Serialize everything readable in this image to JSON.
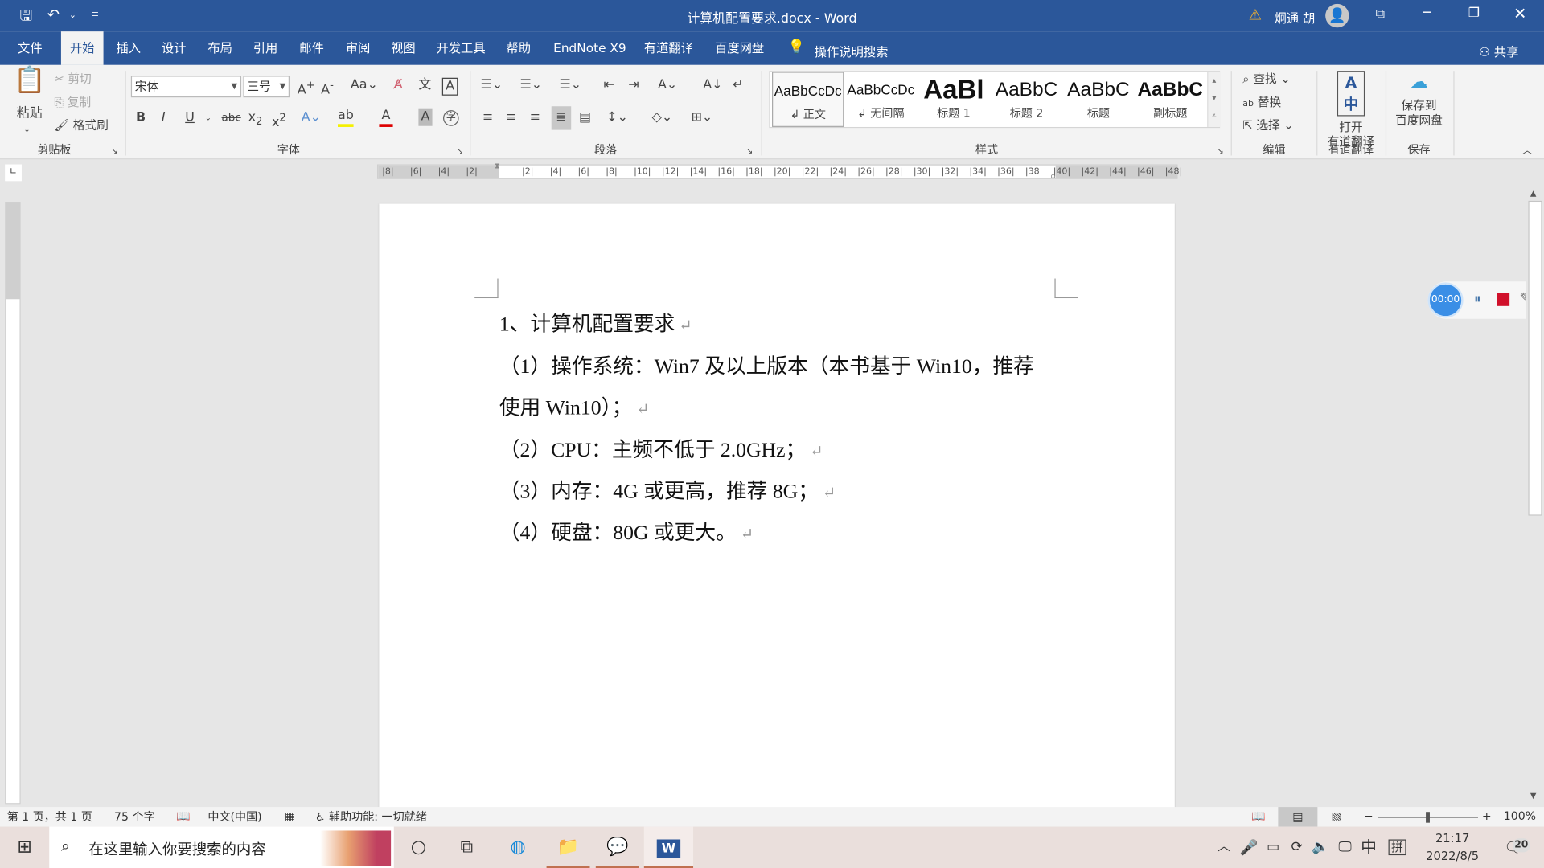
{
  "window": {
    "title": "计算机配置要求.docx - Word",
    "user": "炯通 胡",
    "colors": {
      "brand": "#2b579a",
      "ribbon": "#f3f3f3"
    }
  },
  "qat": {
    "icons": [
      "save-icon",
      "undo-icon",
      "customize-icon"
    ]
  },
  "tabs": [
    {
      "label": "文件"
    },
    {
      "label": "开始",
      "active": true
    },
    {
      "label": "插入"
    },
    {
      "label": "设计"
    },
    {
      "label": "布局"
    },
    {
      "label": "引用"
    },
    {
      "label": "邮件"
    },
    {
      "label": "审阅"
    },
    {
      "label": "视图"
    },
    {
      "label": "开发工具"
    },
    {
      "label": "帮助"
    },
    {
      "label": "EndNote X9"
    },
    {
      "label": "有道翻译"
    },
    {
      "label": "百度网盘"
    }
  ],
  "tell_me": "操作说明搜索",
  "share": "共享",
  "ribbon": {
    "clipboard": {
      "label": "剪贴板",
      "paste": "粘贴",
      "cut": "剪切",
      "copy": "复制",
      "format_painter": "格式刷"
    },
    "font": {
      "label": "字体",
      "font_name": "宋体",
      "font_size": "三号"
    },
    "paragraph": {
      "label": "段落"
    },
    "styles": {
      "label": "样式",
      "items": [
        {
          "preview": "AaBbCcDc",
          "name": "↲ 正文"
        },
        {
          "preview": "AaBbCcDc",
          "name": "↲ 无间隔"
        },
        {
          "preview": "AaBl",
          "name": "标题 1"
        },
        {
          "preview": "AaBbC",
          "name": "标题 2"
        },
        {
          "preview": "AaBbC",
          "name": "标题"
        },
        {
          "preview": "AaBbC",
          "name": "副标题"
        }
      ]
    },
    "editing": {
      "label": "编辑",
      "find": "查找",
      "replace": "替换",
      "select": "选择"
    },
    "youdao": {
      "label": "有道翻译",
      "button_line1": "打开",
      "button_line2": "有道翻译"
    },
    "save": {
      "label": "保存",
      "button_line1": "保存到",
      "button_line2": "百度网盘"
    }
  },
  "ruler": {
    "labels": [
      "8",
      "6",
      "4",
      "2",
      "",
      "2",
      "4",
      "6",
      "8",
      "10",
      "12",
      "14",
      "16",
      "18",
      "20",
      "22",
      "24",
      "26",
      "28",
      "30",
      "32",
      "34",
      "36",
      "38",
      "40",
      "42",
      "44",
      "46",
      "48"
    ]
  },
  "document": {
    "lines": [
      "1、计算机配置要求",
      "（1）操作系统：Win7 及以上版本（本书基于 Win10，推荐",
      "使用 Win10）；",
      "（2）CPU：主频不低于 2.0GHz；",
      "（3）内存：4G 或更高，推荐 8G；",
      "（4）硬盘：80G 或更大。"
    ],
    "return_mark": "↵"
  },
  "recorder": {
    "time": "00:00"
  },
  "status": {
    "page": "第 1 页，共 1 页",
    "words": "75 个字",
    "language": "中文(中国)",
    "accessibility": "辅助功能: 一切就绪",
    "zoom": "100%",
    "zoom_level": 100
  },
  "taskbar": {
    "search_placeholder": "在这里输入你要搜索的内容",
    "time": "21:17",
    "date": "2022/8/5",
    "ime": "中",
    "ime2": "拼",
    "notifications": "20"
  }
}
